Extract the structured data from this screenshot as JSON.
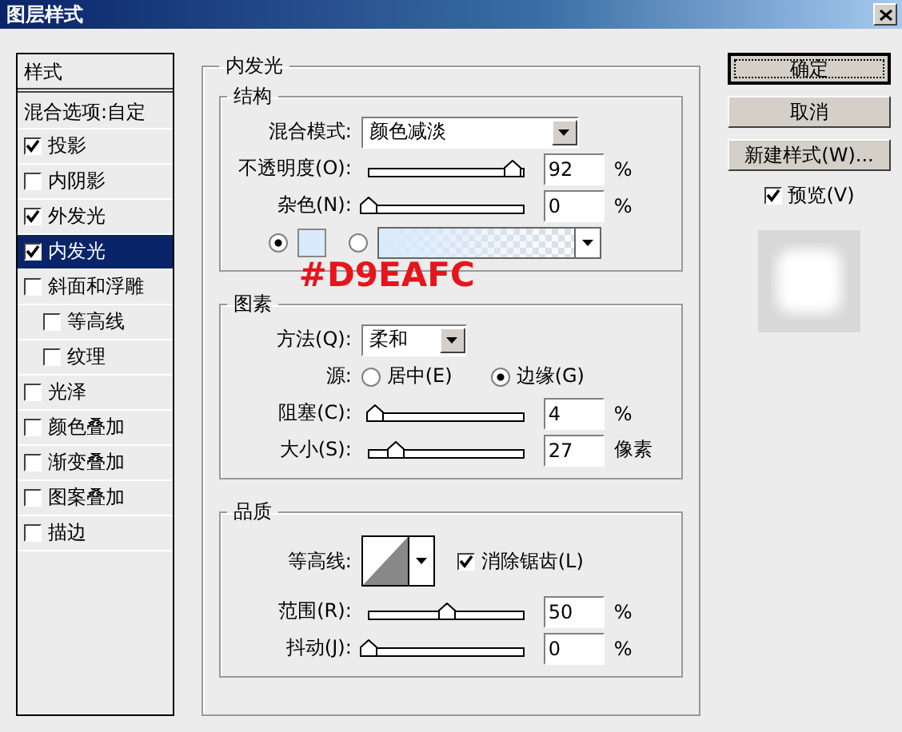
{
  "window": {
    "title": "图层样式"
  },
  "styles_list": {
    "header": "样式",
    "blending": "混合选项:自定",
    "items": [
      {
        "label": "投影",
        "checked": true,
        "selected": false
      },
      {
        "label": "内阴影",
        "checked": false,
        "selected": false
      },
      {
        "label": "外发光",
        "checked": true,
        "selected": false
      },
      {
        "label": "内发光",
        "checked": true,
        "selected": true
      },
      {
        "label": "斜面和浮雕",
        "checked": false,
        "selected": false,
        "children": [
          {
            "label": "等高线",
            "checked": false,
            "selected": false
          },
          {
            "label": "纹理",
            "checked": false,
            "selected": false
          }
        ]
      },
      {
        "label": "光泽",
        "checked": false,
        "selected": false
      },
      {
        "label": "颜色叠加",
        "checked": false,
        "selected": false
      },
      {
        "label": "渐变叠加",
        "checked": false,
        "selected": false
      },
      {
        "label": "图案叠加",
        "checked": false,
        "selected": false
      },
      {
        "label": "描边",
        "checked": false,
        "selected": false
      }
    ]
  },
  "panel": {
    "title": "内发光",
    "structure": {
      "title": "结构",
      "blend_mode": {
        "label": "混合模式:",
        "value": "颜色减淡"
      },
      "sliders": [
        {
          "label": "不透明度(O):",
          "level": 0.92,
          "value": "92",
          "unit": "%"
        },
        {
          "label": "杂色(N):",
          "level": 0,
          "value": "0",
          "unit": "%"
        }
      ],
      "fill_options": [
        {
          "kind": "color",
          "selected": true
        },
        {
          "kind": "gradient",
          "selected": false
        }
      ]
    },
    "annotation": "#D9EAFC",
    "elements": {
      "title": "图素",
      "method": {
        "label": "方法(Q):",
        "value": "柔和"
      },
      "source": {
        "label": "源:",
        "options": [
          {
            "label": "居中(E)",
            "selected": false
          },
          {
            "label": "边缘(G)",
            "selected": true
          }
        ]
      },
      "sliders": [
        {
          "label": "阻塞(C):",
          "level": 0.04,
          "value": "4",
          "unit": "%"
        },
        {
          "label": "大小(S):",
          "level": 0.17,
          "value": "27",
          "unit": "像素"
        }
      ]
    },
    "quality": {
      "title": "品质",
      "contour": {
        "label": "等高线:"
      },
      "antialias": {
        "label": "消除锯齿(L)",
        "checked": true
      },
      "sliders": [
        {
          "label": "范围(R):",
          "level": 0.5,
          "value": "50",
          "unit": "%"
        },
        {
          "label": "抖动(J):",
          "level": 0,
          "value": "0",
          "unit": "%"
        }
      ]
    }
  },
  "buttons": [
    {
      "label": "确定",
      "default": true
    },
    {
      "label": "取消",
      "default": false
    },
    {
      "label": "新建样式(W)...",
      "default": false
    }
  ],
  "preview": {
    "label": "预览(V)",
    "checked": true
  }
}
